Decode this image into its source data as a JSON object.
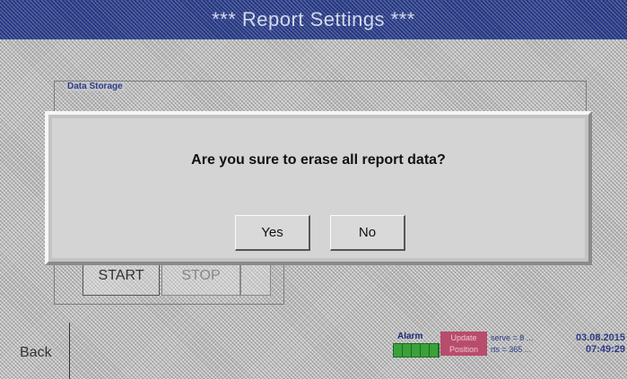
{
  "header": {
    "title": "*** Report Settings ***"
  },
  "panel": {
    "label": "Data Storage"
  },
  "controls": {
    "start_label": "START",
    "stop_label": "STOP"
  },
  "dialog": {
    "message": "Are you sure to erase all report data?",
    "yes_label": "Yes",
    "no_label": "No"
  },
  "footer": {
    "back_label": "Back",
    "alarm_label": "Alarm",
    "update_label": "Update",
    "position_label": "Position",
    "info_line1": "serve = 8 ...",
    "info_line2": "rts = 365 ...",
    "date": "03.08.2015",
    "time": "07:49:29"
  },
  "colors": {
    "title_bar": "#2b3f8f",
    "alarm_ok": "#3aa23a",
    "status_pink": "#b84c6c"
  }
}
